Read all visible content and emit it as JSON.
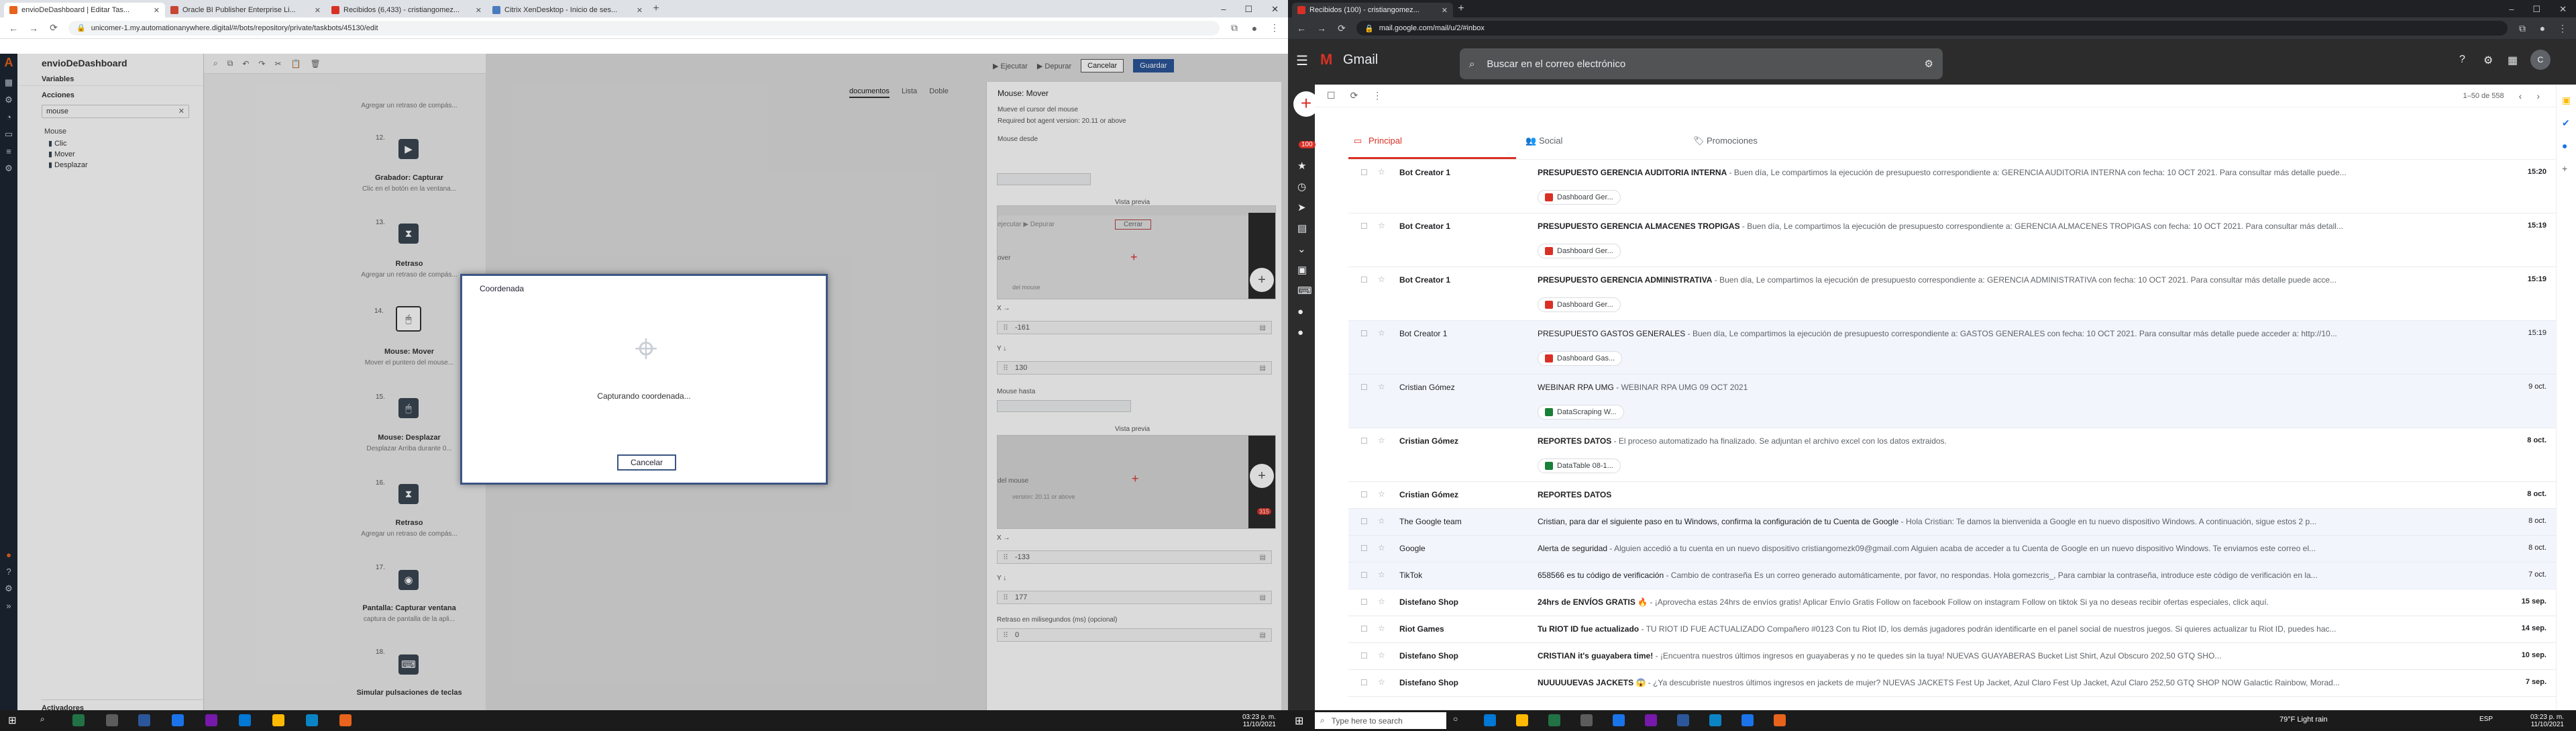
{
  "left_browser": {
    "tabs": [
      {
        "title": "envioDeDashboard | Editar Tas..."
      },
      {
        "title": "Oracle BI Publisher Enterprise Li..."
      },
      {
        "title": "Recibidos (6,433) - cristiangomez..."
      },
      {
        "title": "Citrix XenDesktop - Inicio de ses..."
      }
    ],
    "url": "unicomer-1.my.automationanywhere.digital/#/bots/repository/private/taskbots/45130/edit"
  },
  "aa_editor": {
    "bot_name": "envioDeDashboard",
    "variables_title": "Variables",
    "acciones_title": "Acciones",
    "search_value": "mouse",
    "group_title": "Mouse",
    "actions": [
      "Clic",
      "Mover",
      "Desplazar"
    ],
    "activadores_title": "Activadores",
    "toolbar": {
      "ejecutar": "Ejecutar",
      "depurar": "Depurar",
      "cancelar": "Cancelar",
      "guardar": "Guardar"
    },
    "view_tabs": [
      "documentos",
      "Lista",
      "Doble"
    ],
    "steps": [
      {
        "num": "12.",
        "title": "Grabador: Capturar",
        "desc": "Clic en el botón en la ventana..."
      },
      {
        "num": "13.",
        "title": "Retraso",
        "desc": "Agregar un retraso de compás..."
      },
      {
        "num": "14.",
        "title": "Mouse: Mover",
        "desc": "Mover el puntero del mouse..."
      },
      {
        "num": "15.",
        "title": "Mouse: Desplazar",
        "desc": "Desplazar Arriba durante 0..."
      },
      {
        "num": "16.",
        "title": "Retraso",
        "desc": "Agregar un retraso de compás..."
      },
      {
        "num": "17.",
        "title": "Pantalla: Capturar ventana",
        "desc": "captura de pantalla de la apli..."
      },
      {
        "num": "18.",
        "title": "Simular pulsaciones de teclas",
        "desc": ""
      }
    ],
    "top_step_desc": "Agregar un retraso de compás...",
    "props": {
      "title": "Mouse: Mover",
      "desc": "Mueve el cursor del mouse",
      "version": "Required bot agent version: 20.11 or above",
      "mouse_desde": "Mouse desde",
      "vista_previa": "Vista previa",
      "x_label": "X",
      "y_label": "Y",
      "x_from": "-161",
      "y_from": "130",
      "mouse_hasta": "Mouse hasta",
      "x_to": "-133",
      "y_to": "177",
      "retraso_label": "Retraso en milisegundos (ms) (opcional)",
      "retraso_value": "0",
      "preview_cerrar": "Cerrar",
      "preview_ejecutar": "ejecutar",
      "preview_depurar": "Depurar",
      "preview_mover": "over",
      "preview_mouse": "del mouse",
      "preview_version": "version: 20.11 or above",
      "preview_badge": "315"
    },
    "dialog": {
      "title": "Coordenada",
      "message": "Capturando coordenada...",
      "cancel": "Cancelar"
    }
  },
  "left_taskbar": {
    "time": "03:23 p. m.",
    "date": "11/10/2021"
  },
  "right_browser": {
    "tab_title": "Recibidos (100) - cristiangomez...",
    "url": "mail.google.com/mail/u/2/#inbox"
  },
  "gmail": {
    "brand": "Gmail",
    "search_placeholder": "Buscar en el correo electrónico",
    "range": "1–50 de 558",
    "tabs": [
      "Principal",
      "Social",
      "Promociones"
    ],
    "badge": "100",
    "emails": [
      {
        "sender": "Bot Creator 1",
        "subject": "PRESUPUESTO GERENCIA AUDITORIA INTERNA",
        "snippet": " - Buen día, Le compartimos la ejecución de presupuesto correspondiente a: GERENCIA AUDITORIA INTERNA con fecha: 10 OCT 2021. Para consultar más detalle puede...",
        "date": "15:20",
        "chip": "Dashboard Ger...",
        "unread": true
      },
      {
        "sender": "Bot Creator 1",
        "subject": "PRESUPUESTO GERENCIA ALMACENES TROPIGAS",
        "snippet": " - Buen día, Le compartimos la ejecución de presupuesto correspondiente a: GERENCIA ALMACENES TROPIGAS con fecha: 10 OCT 2021. Para consultar más detall...",
        "date": "15:19",
        "chip": "Dashboard Ger...",
        "unread": true
      },
      {
        "sender": "Bot Creator 1",
        "subject": "PRESUPUESTO GERENCIA ADMINISTRATIVA",
        "snippet": " - Buen día, Le compartimos la ejecución de presupuesto correspondiente a: GERENCIA ADMINISTRATIVA con fecha: 10 OCT 2021. Para consultar más detalle puede acce...",
        "date": "15:19",
        "chip": "Dashboard Ger...",
        "unread": true
      },
      {
        "sender": "Bot Creator 1",
        "subject": "PRESUPUESTO GASTOS GENERALES",
        "snippet": " - Buen día, Le compartimos la ejecución de presupuesto correspondiente a: GASTOS GENERALES con fecha: 10 OCT 2021. Para consultar más detalle puede acceder a: http://10...",
        "date": "15:19",
        "chip": "Dashboard Gas...",
        "unread": false
      },
      {
        "sender": "Cristian Gómez",
        "subject": "WEBINAR RPA UMG",
        "snippet": " - WEBINAR RPA UMG 09 OCT 2021",
        "date": "9 oct.",
        "chip": "DataScraping W...",
        "unread": false
      },
      {
        "sender": "Cristian Gómez",
        "subject": "REPORTES DATOS",
        "snippet": " - El proceso automatizado ha finalizado. Se adjuntan el archivo excel con los datos extraidos.",
        "date": "8 oct.",
        "chip": "DataTable 08-1...",
        "unread": true
      },
      {
        "sender": "Cristian Gómez",
        "subject": "REPORTES DATOS",
        "snippet": "",
        "date": "8 oct.",
        "chip": "",
        "unread": true
      },
      {
        "sender": "The Google team",
        "subject": "Cristian, para dar el siguiente paso en tu Windows, confirma la configuración de tu Cuenta de Google",
        "snippet": " - Hola Cristian: Te damos la bienvenida a Google en tu nuevo dispositivo Windows. A continuación, sigue estos 2 p...",
        "date": "8 oct.",
        "chip": "",
        "unread": false
      },
      {
        "sender": "Google",
        "subject": "Alerta de seguridad",
        "snippet": " - Alguien accedió a tu cuenta en un nuevo dispositivo cristiangomezk09@gmail.com Alguien acaba de acceder a tu Cuenta de Google en un nuevo dispositivo Windows. Te enviamos este correo el...",
        "date": "8 oct.",
        "chip": "",
        "unread": false
      },
      {
        "sender": "TikTok",
        "subject": "658566 es tu código de verificación",
        "snippet": " - Cambio de contraseña Es un correo generado automáticamente, por favor, no respondas. Hola gomezcris_, Para cambiar la contraseña, introduce este código de verificación en la...",
        "date": "7 oct.",
        "chip": "",
        "unread": false
      },
      {
        "sender": "Distefano Shop",
        "subject": "24hrs de ENVÍOS GRATIS 🔥",
        "snippet": " - ¡Aprovecha estas 24hrs de envíos gratis! Aplicar Envío Gratis Follow on facebook Follow on instagram Follow on tiktok Si ya no deseas recibir ofertas especiales, click aquí.",
        "date": "15 sep.",
        "chip": "",
        "unread": true
      },
      {
        "sender": "Riot Games",
        "subject": "Tu RIOT ID fue actualizado",
        "snippet": " - TU RIOT ID FUE ACTUALIZADO Compañero #0123 Con tu Riot ID, los demás jugadores podrán identificarte en el panel social de nuestros juegos. Si quieres actualizar tu Riot ID, puedes hac...",
        "date": "14 sep.",
        "chip": "",
        "unread": true
      },
      {
        "sender": "Distefano Shop",
        "subject": "CRISTIAN it's guayabera time!",
        "snippet": " - ¡Encuentra nuestros últimos ingresos en guayaberas y no te quedes sin la tuya! NUEVAS GUAYABERAS Bucket List Shirt, Azul Obscuro 202,50 GTQ SHO...",
        "date": "10 sep.",
        "chip": "",
        "unread": true
      },
      {
        "sender": "Distefano Shop",
        "subject": "NUUUUUEVAS JACKETS 😱",
        "snippet": " - ¿Ya descubriste nuestros últimos ingresos en jackets de mujer? NUEVAS JACKETS Fest Up Jacket, Azul Claro Fest Up Jacket, Azul Claro 252,50 GTQ SHOP NOW Galactic Rainbow, Morad...",
        "date": "7 sep.",
        "chip": "",
        "unread": true
      }
    ]
  },
  "right_taskbar": {
    "search_placeholder": "Type here to search",
    "weather": "79°F  Light rain",
    "lang": "ESP",
    "time": "03:23 p. m.",
    "date": "11/10/2021"
  },
  "colors": {
    "aa_dark": "#1c2733",
    "gmail_red": "#d93025",
    "gmail_blue": "#1a73e8",
    "dialog_border": "#3a5683",
    "guardar": "#2a5599"
  }
}
